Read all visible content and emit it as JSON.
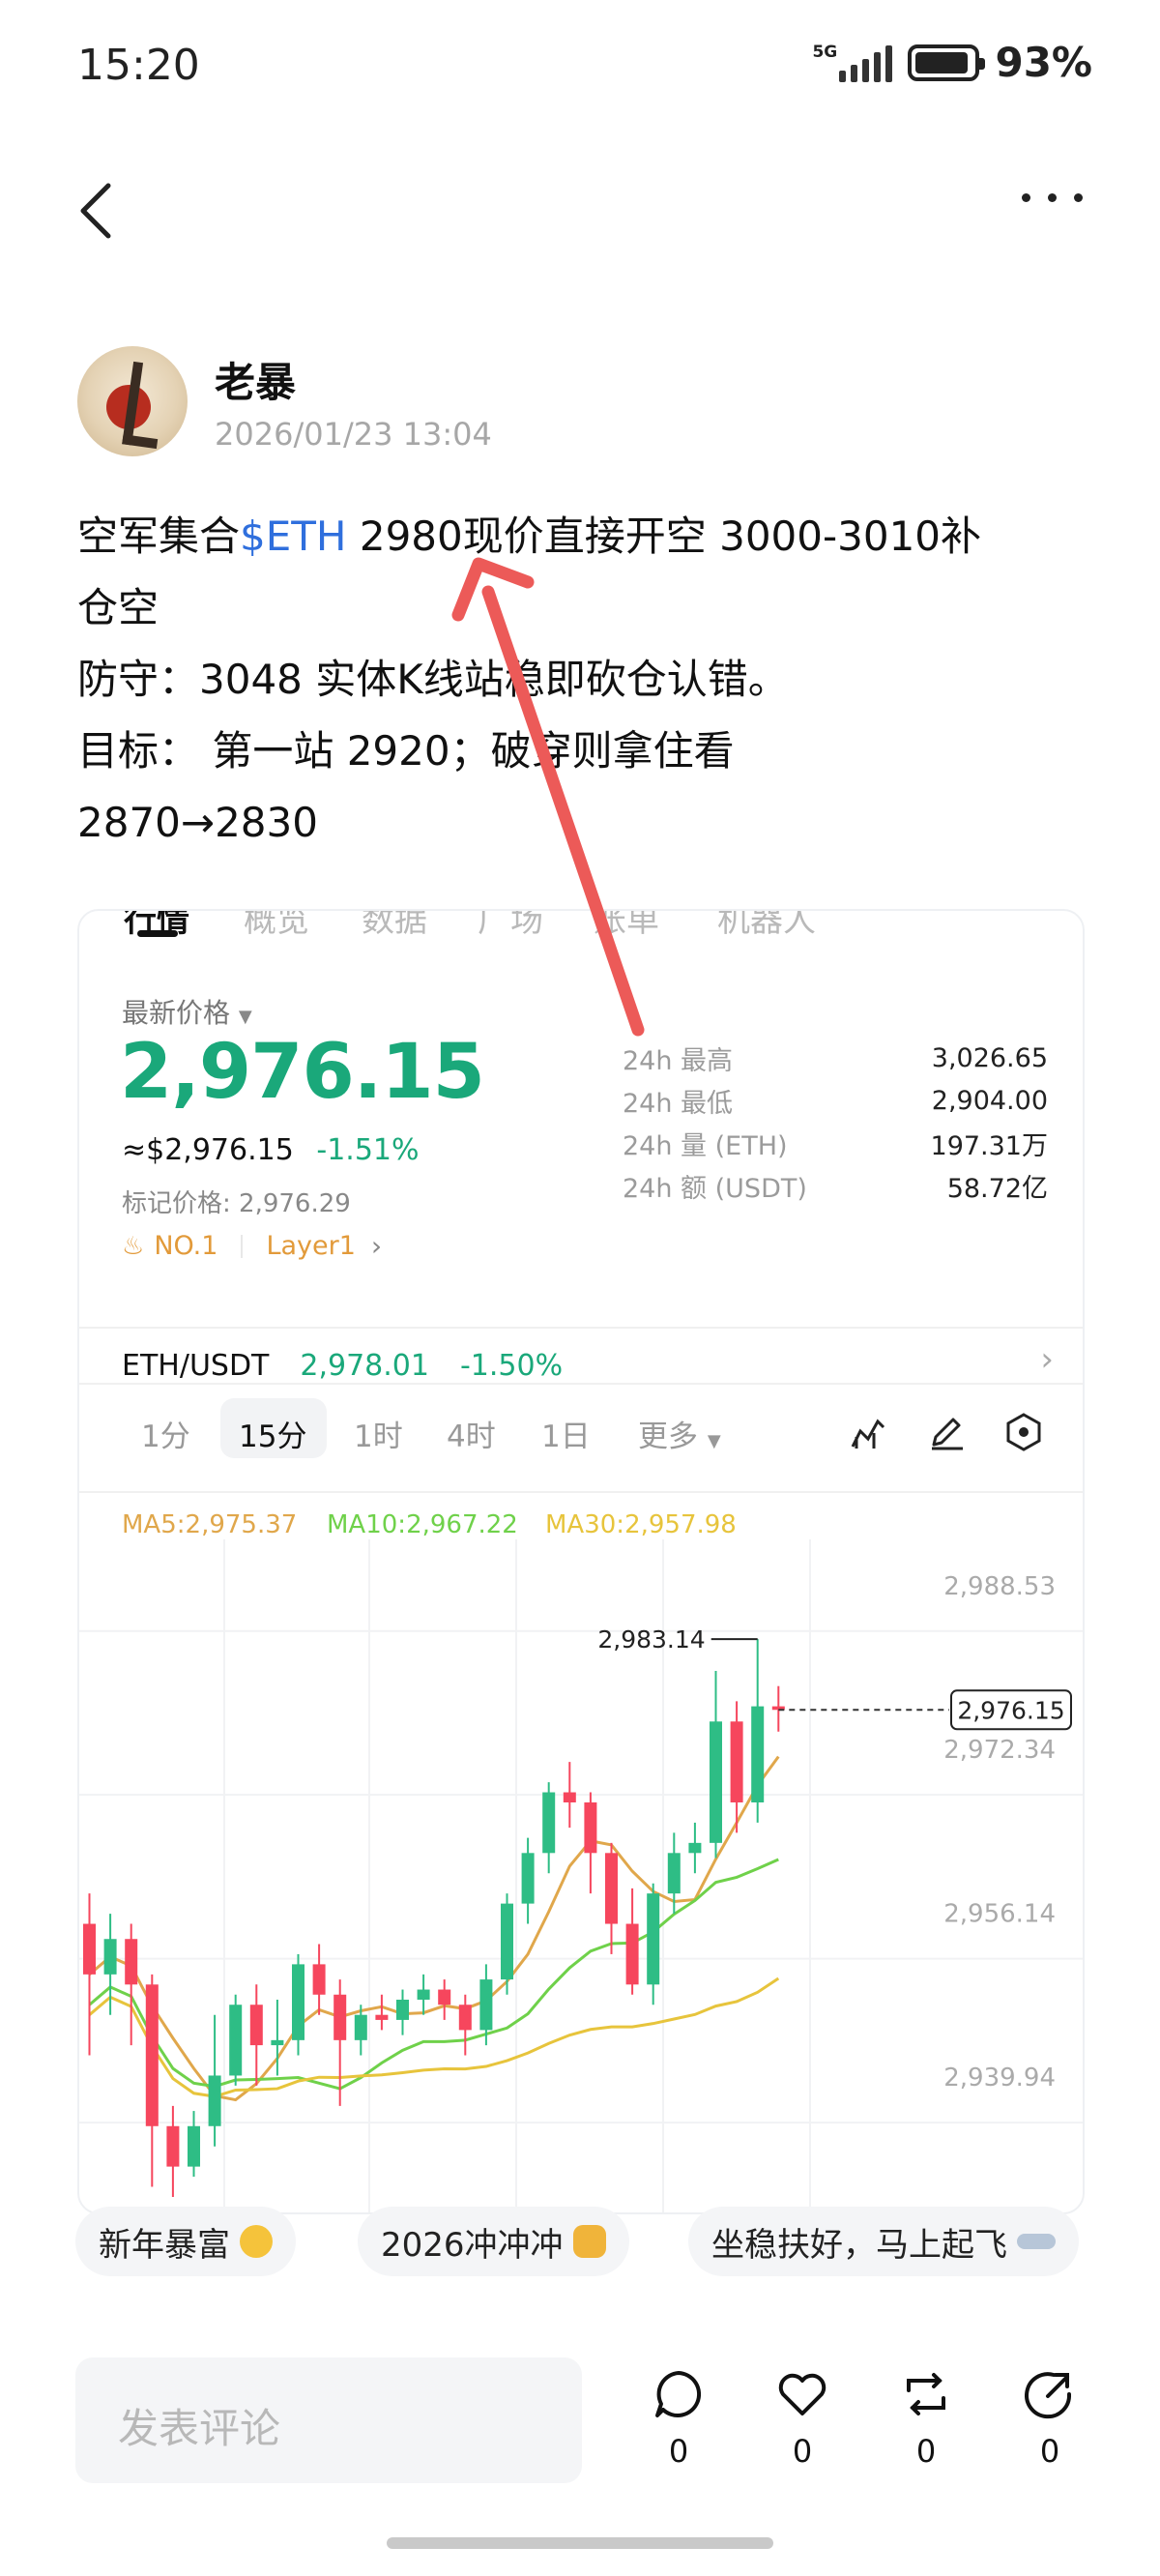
{
  "status_bar": {
    "time": "15:20",
    "network": "5G",
    "battery_level": 0.93,
    "battery": "93%"
  },
  "post": {
    "author": "老暴",
    "avatar_text": "老暴",
    "timestamp": "2026/01/23 13:04",
    "line1_prefix": "空军集合",
    "line1_tag": "$ETH",
    "line1_rest": " 2980现价直接开空 3000-3010补",
    "line2": "仓空",
    "line3": "防守：3048 实体K线站稳即砍仓认错。",
    "line4": "目标：  第一站 2920；破穿则拿住看",
    "line5": "2870→2830"
  },
  "market": {
    "tabs": [
      "行情",
      "概览",
      "数据",
      "广场",
      "账单",
      "机器人"
    ],
    "latest_price_label": "最新价格",
    "price": "2,976.15",
    "usd_value": "≈$2,976.15",
    "change": "-1.51%",
    "mark_price": "标记价格: 2,976.29",
    "rank": "NO.1",
    "category": "Layer1",
    "stats": [
      {
        "label": "24h  最高",
        "value": "3,026.65"
      },
      {
        "label": "24h  最低",
        "value": "2,904.00"
      },
      {
        "label": "24h  量 (ETH)",
        "value": "197.31万"
      },
      {
        "label": "24h  额 (USDT)",
        "value": "58.72亿"
      }
    ],
    "pair": "ETH/USDT",
    "pair_price": "2,978.01",
    "pair_change": "-1.50%",
    "timeframes": [
      "1分",
      "15分",
      "1时",
      "4时",
      "1日",
      "更多"
    ],
    "active_timeframe": "15分"
  },
  "chart_data": {
    "type": "candlestick",
    "title": "",
    "ylabels": [
      "2,988.53",
      "2,972.34",
      "2,956.14",
      "2,939.94"
    ],
    "y_ticks": [
      2988.53,
      2972.34,
      2956.14,
      2939.94
    ],
    "ylim": [
      2928,
      2993
    ],
    "ma": [
      {
        "name": "MA5",
        "label": "MA5:2,975.37",
        "color": "#e0a74b",
        "latest": 2975.37
      },
      {
        "name": "MA10",
        "label": "MA10:2,967.22",
        "color": "#6fd14a",
        "latest": 2967.22
      },
      {
        "name": "MA30",
        "label": "MA30:2,957.98",
        "color": "#e7c43c",
        "latest": 2957.98
      }
    ],
    "current_price": 2976.15,
    "current_price_label": "2,976.15",
    "high_annotation": "2,983.14",
    "candles": [
      [
        2955.0,
        2950.0,
        2958.0,
        2942.0
      ],
      [
        2950.0,
        2953.5,
        2956.0,
        2946.0
      ],
      [
        2953.5,
        2949.0,
        2955.0,
        2943.0
      ],
      [
        2949.0,
        2935.0,
        2950.0,
        2929.0
      ],
      [
        2935.0,
        2931.0,
        2937.0,
        2928.0
      ],
      [
        2931.0,
        2935.0,
        2936.5,
        2930.0
      ],
      [
        2935.0,
        2940.0,
        2946.0,
        2933.0
      ],
      [
        2940.0,
        2947.0,
        2948.0,
        2939.0
      ],
      [
        2947.0,
        2943.0,
        2949.0,
        2939.0
      ],
      [
        2943.0,
        2943.5,
        2947.5,
        2940.0
      ],
      [
        2943.5,
        2951.0,
        2952.0,
        2942.0
      ],
      [
        2951.0,
        2948.0,
        2953.0,
        2946.0
      ],
      [
        2948.0,
        2943.5,
        2949.5,
        2937.0
      ],
      [
        2943.5,
        2946.0,
        2947.0,
        2942.0
      ],
      [
        2946.0,
        2945.5,
        2948.0,
        2944.5
      ],
      [
        2945.5,
        2947.5,
        2948.5,
        2944.0
      ],
      [
        2947.5,
        2948.5,
        2950.0,
        2946.0
      ],
      [
        2948.5,
        2947.0,
        2949.5,
        2945.5
      ],
      [
        2947.0,
        2944.5,
        2948.0,
        2942.0
      ],
      [
        2944.5,
        2949.5,
        2951.0,
        2943.0
      ],
      [
        2949.5,
        2957.0,
        2958.0,
        2948.0
      ],
      [
        2957.0,
        2962.0,
        2963.5,
        2955.0
      ],
      [
        2962.0,
        2968.0,
        2969.0,
        2960.0
      ],
      [
        2968.0,
        2967.0,
        2971.0,
        2964.5
      ],
      [
        2967.0,
        2962.0,
        2968.0,
        2958.0
      ],
      [
        2962.0,
        2955.0,
        2963.0,
        2952.0
      ],
      [
        2955.0,
        2949.0,
        2958.5,
        2948.0
      ],
      [
        2949.0,
        2958.0,
        2959.0,
        2947.0
      ],
      [
        2958.0,
        2962.0,
        2964.0,
        2956.0
      ],
      [
        2962.0,
        2963.0,
        2965.0,
        2960.0
      ],
      [
        2963.0,
        2975.0,
        2980.0,
        2961.5
      ],
      [
        2975.0,
        2967.0,
        2977.0,
        2964.0
      ],
      [
        2967.0,
        2976.5,
        2983.14,
        2965.0
      ],
      [
        2976.5,
        2976.15,
        2978.5,
        2974.0
      ]
    ]
  },
  "reactions": [
    {
      "label": "新年暴富",
      "icon": "money-face-icon"
    },
    {
      "label": "2026冲冲冲",
      "icon": "fist-icon"
    },
    {
      "label": "坐稳扶好，马上起飞",
      "icon": "airplane-icon"
    }
  ],
  "comment_placeholder": "发表评论",
  "actions": [
    {
      "name": "comment",
      "count": "0"
    },
    {
      "name": "like",
      "count": "0"
    },
    {
      "name": "repost",
      "count": "0"
    },
    {
      "name": "share",
      "count": "0"
    }
  ]
}
